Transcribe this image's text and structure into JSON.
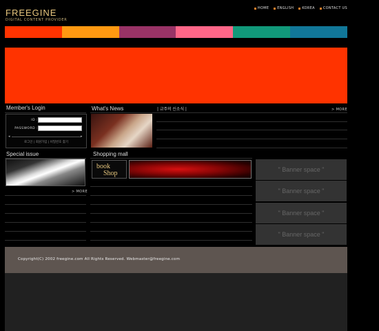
{
  "brand": {
    "title": "FREEGINE",
    "subtitle": "DIGITAL CONTENT PROVIDER"
  },
  "topnav": [
    {
      "label": "HOME"
    },
    {
      "label": "ENGLISH"
    },
    {
      "label": "KOREA"
    },
    {
      "label": "CONTACT US"
    }
  ],
  "colorbar": [
    "#ff3300",
    "#ff9911",
    "#993366",
    "#ff6688",
    "#11997a",
    "#117799"
  ],
  "hero": {
    "color": "#ff3300"
  },
  "login": {
    "title": "Member's Login",
    "id_label": "ID :",
    "password_label": "PASSWORD :",
    "id_value": "",
    "password_value": "",
    "links": [
      "로그인",
      "회원가입",
      "비밀번호 찾기"
    ]
  },
  "news": {
    "title": "What's News",
    "tab": "교주의 신소식",
    "more": "> MORE"
  },
  "special": {
    "title": "Special issue",
    "more": "> MORE"
  },
  "shop": {
    "title": "Shopping mall",
    "logo_line1": "book",
    "logo_line2": "Shop"
  },
  "banners": [
    "\" Banner space \"",
    "\" Banner space \"",
    "\" Banner space \"",
    "\" Banner space \""
  ],
  "footer": {
    "text": "Copyright(C) 2002 freegine.com  All Rights Reserved. Webmaster@freegine.com"
  }
}
